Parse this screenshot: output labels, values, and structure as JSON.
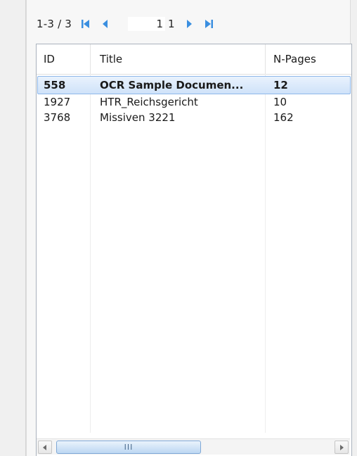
{
  "pager": {
    "range_label": "1-3 / 3",
    "current_page": "1",
    "total_pages": "1",
    "icons": [
      "first-page-icon",
      "previous-page-icon",
      "next-page-icon",
      "last-page-icon"
    ],
    "accent_color": "#3b8fe0"
  },
  "table": {
    "columns": [
      {
        "label": "ID"
      },
      {
        "label": "Title"
      },
      {
        "label": "N-Pages"
      }
    ],
    "rows": [
      {
        "id": "558",
        "title": "OCR Sample Documen...",
        "pages": "12",
        "selected": true
      },
      {
        "id": "1927",
        "title": "HTR_Reichsgericht",
        "pages": "10",
        "selected": false
      },
      {
        "id": "3768",
        "title": "Missiven 3221",
        "pages": "162",
        "selected": false
      }
    ],
    "selection_color": "#cfe2f9"
  },
  "scrollbar": {
    "grip_label": "III",
    "icons": [
      "scroll-left-icon",
      "scroll-right-icon"
    ]
  }
}
